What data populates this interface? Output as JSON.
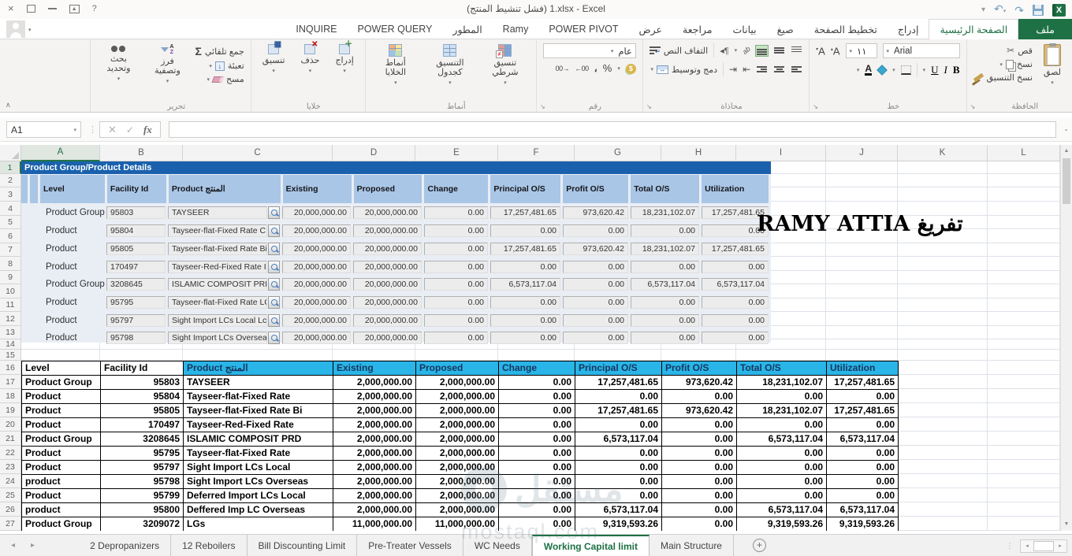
{
  "window": {
    "title": "(فشل تنشيط المنتج) 1.xlsx - Excel",
    "controls": [
      "close-icon",
      "restore-icon",
      "minimize-icon",
      "ribbon-display-options-icon",
      "help-icon"
    ],
    "quick_access": [
      "customize-quick-access-icon",
      "undo-icon",
      "redo-icon",
      "save-icon",
      "excel-logo"
    ]
  },
  "ribbon_tabs": [
    {
      "label": "ملف",
      "type": "file"
    },
    {
      "label": "الصفحة الرئيسية",
      "active": true
    },
    {
      "label": "إدراج"
    },
    {
      "label": "تخطيط الصفحة"
    },
    {
      "label": "صيغ"
    },
    {
      "label": "بيانات"
    },
    {
      "label": "مراجعة"
    },
    {
      "label": "عرض"
    },
    {
      "label": "POWER PIVOT"
    },
    {
      "label": "Ramy"
    },
    {
      "label": "المطور"
    },
    {
      "label": "POWER QUERY"
    },
    {
      "label": "INQUIRE"
    }
  ],
  "ribbon": {
    "clipboard": {
      "label": "الحافظة",
      "paste": "لصق",
      "cut": "قص",
      "copy": "نسخ",
      "format_painter": "نسخ التنسيق"
    },
    "font": {
      "label": "خط",
      "font_name": "Arial",
      "font_size": "١١",
      "bold": "B",
      "italic": "I",
      "underline": "U"
    },
    "alignment": {
      "label": "محاذاة",
      "wrap_text": "التفاف النص",
      "merge_center": "دمج وتوسيط"
    },
    "number": {
      "label": "رقم",
      "format": "عام",
      "percent": "%",
      "comma": "،",
      "inc_decimal": "00←",
      "dec_decimal": "→00"
    },
    "styles": {
      "label": "أنماط",
      "items": [
        "تنسيق شرطي",
        "التنسيق كجدول",
        "أنماط الخلايا"
      ]
    },
    "cells": {
      "label": "خلايا",
      "items": [
        "إدراج",
        "حذف",
        "تنسيق"
      ]
    },
    "editing": {
      "label": "تحرير",
      "autosum": "جمع تلقائي",
      "fill": "تعبئة",
      "clear": "مسح",
      "sort_filter": "فرز وتصفية",
      "find_select": "بحث وتحديد"
    }
  },
  "formula_bar": {
    "name_box": "A1",
    "fx": "fx",
    "value": ""
  },
  "grid": {
    "columns": [
      "A",
      "B",
      "C",
      "D",
      "E",
      "F",
      "G",
      "H",
      "I",
      "J",
      "K",
      "L"
    ],
    "row_count": 27,
    "selected_column": "A",
    "selected_row": 1
  },
  "sheet": {
    "title_banner": "Product Group/Product Details",
    "annotation": "RAMY ATTIA تفريغ",
    "form": {
      "headers": [
        "Level",
        "Facility Id",
        "Product المنتج",
        "Existing",
        "Proposed",
        "Change",
        "Principal O/S",
        "Profit O/S",
        "Total O/S",
        "Utilization"
      ],
      "rows": [
        {
          "level": "Product Group",
          "facility_id": "95803",
          "product": "TAYSEER",
          "values": [
            "20,000,000.00",
            "20,000,000.00",
            "0.00",
            "17,257,481.65",
            "973,620.42",
            "18,231,102.07",
            "17,257,481.65"
          ]
        },
        {
          "level": "Product",
          "facility_id": "95804",
          "product": "Tayseer-flat-Fixed Rate  C",
          "values": [
            "20,000,000.00",
            "20,000,000.00",
            "0.00",
            "0.00",
            "0.00",
            "0.00",
            "0.00"
          ]
        },
        {
          "level": "Product",
          "facility_id": "95805",
          "product": "Tayseer-flat-Fixed Rate  Bi",
          "values": [
            "20,000,000.00",
            "20,000,000.00",
            "0.00",
            "17,257,481.65",
            "973,620.42",
            "18,231,102.07",
            "17,257,481.65"
          ]
        },
        {
          "level": "Product",
          "facility_id": "170497",
          "product": "Tayseer-Red-Fixed Rate  I",
          "values": [
            "20,000,000.00",
            "20,000,000.00",
            "0.00",
            "0.00",
            "0.00",
            "0.00",
            "0.00"
          ]
        },
        {
          "level": "Product Group",
          "facility_id": "3208645",
          "product": "ISLAMIC COMPOSIT PRD G",
          "values": [
            "20,000,000.00",
            "20,000,000.00",
            "0.00",
            "6,573,117.04",
            "0.00",
            "6,573,117.04",
            "6,573,117.04"
          ]
        },
        {
          "level": "Product",
          "facility_id": "95795",
          "product": "Tayseer-flat-Fixed Rate  LC",
          "values": [
            "20,000,000.00",
            "20,000,000.00",
            "0.00",
            "0.00",
            "0.00",
            "0.00",
            "0.00"
          ]
        },
        {
          "level": "Product",
          "facility_id": "95797",
          "product": "Sight Import LCs Local  Lc",
          "values": [
            "20,000,000.00",
            "20,000,000.00",
            "0.00",
            "0.00",
            "0.00",
            "0.00",
            "0.00"
          ]
        },
        {
          "level": "Product",
          "facility_id": "95798",
          "product": "Sight Import LCs Overseas",
          "values": [
            "20,000,000.00",
            "20,000,000.00",
            "0.00",
            "0.00",
            "0.00",
            "0.00",
            "0.00"
          ]
        }
      ]
    },
    "table": {
      "headers": [
        "Level",
        "Facility Id",
        "Product المنتج",
        "Existing",
        "Proposed",
        "Change",
        "Principal O/S",
        "Profit O/S",
        "Total O/S",
        "Utilization"
      ],
      "rows": [
        [
          "Product Group",
          "95803",
          "TAYSEER",
          "2,000,000.00",
          "2,000,000.00",
          "0.00",
          "17,257,481.65",
          "973,620.42",
          "18,231,102.07",
          "17,257,481.65"
        ],
        [
          "Product",
          "95804",
          "Tayseer-flat-Fixed Rate",
          "2,000,000.00",
          "2,000,000.00",
          "0.00",
          "0.00",
          "0.00",
          "0.00",
          "0.00"
        ],
        [
          "Product",
          "95805",
          "Tayseer-flat-Fixed Rate Bi",
          "2,000,000.00",
          "2,000,000.00",
          "0.00",
          "17,257,481.65",
          "973,620.42",
          "18,231,102.07",
          "17,257,481.65"
        ],
        [
          "Product",
          "170497",
          "Tayseer-Red-Fixed Rate",
          "2,000,000.00",
          "2,000,000.00",
          "0.00",
          "0.00",
          "0.00",
          "0.00",
          "0.00"
        ],
        [
          "Product Group",
          "3208645",
          "ISLAMIC COMPOSIT PRD",
          "2,000,000.00",
          "2,000,000.00",
          "0.00",
          "6,573,117.04",
          "0.00",
          "6,573,117.04",
          "6,573,117.04"
        ],
        [
          "Product",
          "95795",
          "Tayseer-flat-Fixed Rate",
          "2,000,000.00",
          "2,000,000.00",
          "0.00",
          "0.00",
          "0.00",
          "0.00",
          "0.00"
        ],
        [
          "Product",
          "95797",
          "Sight Import LCs Local",
          "2,000,000.00",
          "2,000,000.00",
          "0.00",
          "0.00",
          "0.00",
          "0.00",
          "0.00"
        ],
        [
          "product",
          "95798",
          "Sight Import LCs Overseas",
          "2,000,000.00",
          "2,000,000.00",
          "0.00",
          "0.00",
          "0.00",
          "0.00",
          "0.00"
        ],
        [
          "Product",
          "95799",
          "Deferred Import LCs Local",
          "2,000,000.00",
          "2,000,000.00",
          "0.00",
          "0.00",
          "0.00",
          "0.00",
          "0.00"
        ],
        [
          "product",
          "95800",
          "Deffered Imp LC Overseas",
          "2,000,000.00",
          "2,000,000.00",
          "0.00",
          "6,573,117.04",
          "0.00",
          "6,573,117.04",
          "6,573,117.04"
        ],
        [
          "Product Group",
          "3209072",
          "LGs",
          "11,000,000.00",
          "11,000,000.00",
          "0.00",
          "9,319,593.26",
          "0.00",
          "9,319,593.26",
          "9,319,593.26"
        ]
      ]
    }
  },
  "sheet_tabs": {
    "tabs": [
      "2 Depropanizers",
      "12 Reboilers",
      "Bill Discounting Limit",
      "Pre-Treater Vessels",
      "WC Needs",
      "Working Capital limit",
      "Main Structure"
    ],
    "active": "Working Capital limit"
  },
  "watermark": {
    "arabic": "مستقل",
    "latin": "mostaql.com"
  },
  "colors": {
    "excel_green": "#217346",
    "banner_blue": "#1A61AD",
    "form_header_blue": "#A9C6E6",
    "table_header_cyan": "#29B5E8",
    "table_header_text": "#17365D"
  }
}
